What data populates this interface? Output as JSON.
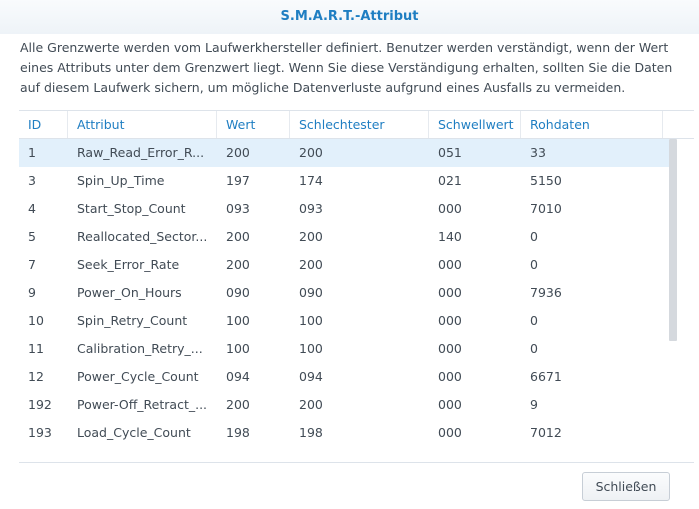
{
  "dialog": {
    "title": "S.M.A.R.T.-Attribut",
    "description": "Alle Grenzwerte werden vom Laufwerkhersteller definiert. Benutzer werden verständigt, wenn der Wert eines Attributs unter dem Grenzwert liegt. Wenn Sie diese Verständigung erhalten, sollten Sie die Daten auf diesem Laufwerk sichern, um mögliche Datenverluste aufgrund eines Ausfalls zu vermeiden.",
    "close_label": "Schließen"
  },
  "table": {
    "columns": [
      "ID",
      "Attribut",
      "Wert",
      "Schlechtester",
      "Schwellwert",
      "Rohdaten"
    ],
    "rows": [
      [
        "1",
        "Raw_Read_Error_R...",
        "200",
        "200",
        "051",
        "33"
      ],
      [
        "3",
        "Spin_Up_Time",
        "197",
        "174",
        "021",
        "5150"
      ],
      [
        "4",
        "Start_Stop_Count",
        "093",
        "093",
        "000",
        "7010"
      ],
      [
        "5",
        "Reallocated_Sector...",
        "200",
        "200",
        "140",
        "0"
      ],
      [
        "7",
        "Seek_Error_Rate",
        "200",
        "200",
        "000",
        "0"
      ],
      [
        "9",
        "Power_On_Hours",
        "090",
        "090",
        "000",
        "7936"
      ],
      [
        "10",
        "Spin_Retry_Count",
        "100",
        "100",
        "000",
        "0"
      ],
      [
        "11",
        "Calibration_Retry_...",
        "100",
        "100",
        "000",
        "0"
      ],
      [
        "12",
        "Power_Cycle_Count",
        "094",
        "094",
        "000",
        "6671"
      ],
      [
        "192",
        "Power-Off_Retract_...",
        "200",
        "200",
        "000",
        "9"
      ],
      [
        "193",
        "Load_Cycle_Count",
        "198",
        "198",
        "000",
        "7012"
      ]
    ],
    "selected_row": 0
  },
  "colors": {
    "accent": "#1f7ec2",
    "selected_row": "#e2f0fb",
    "text": "#414b55"
  }
}
